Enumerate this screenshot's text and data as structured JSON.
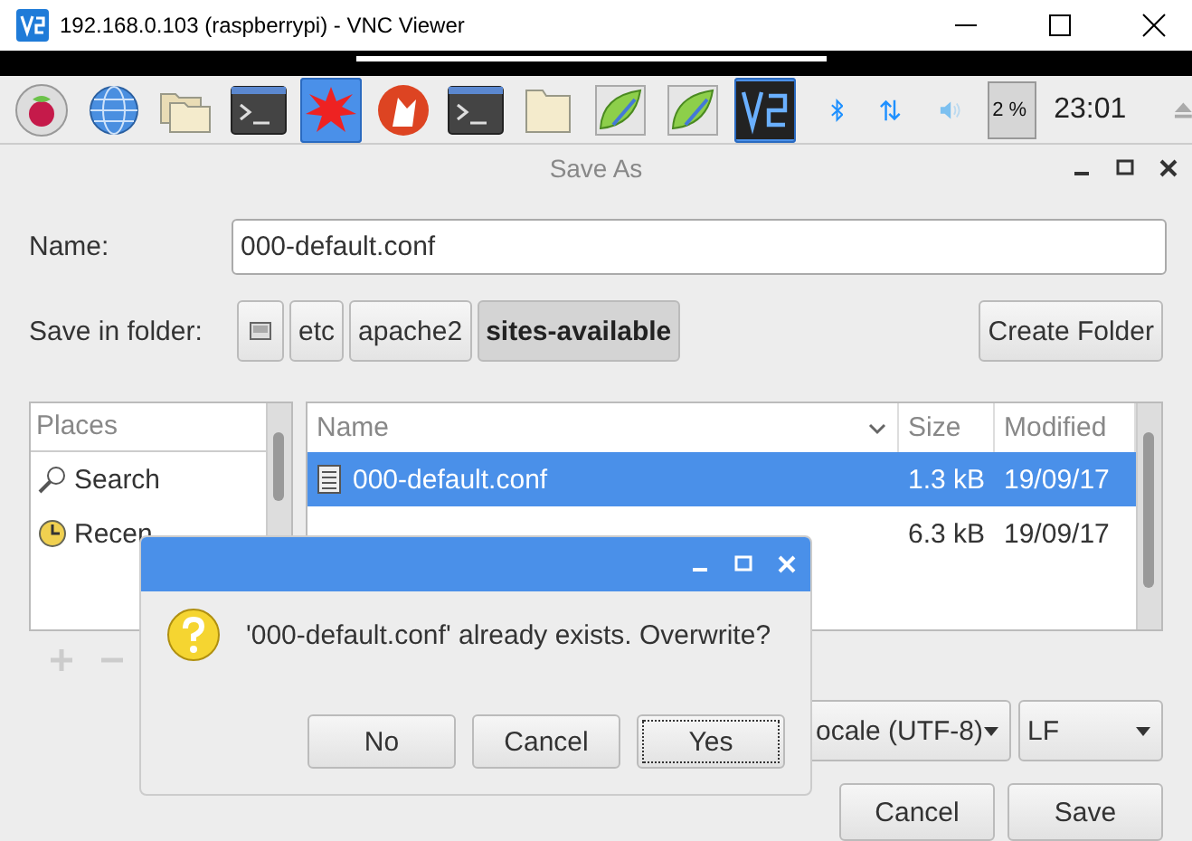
{
  "window": {
    "title": "192.168.0.103 (raspberrypi) - VNC Viewer"
  },
  "taskbar": {
    "launchers": [
      {
        "kind": "raspberry",
        "active": false
      },
      {
        "kind": "globe",
        "active": false
      },
      {
        "kind": "folders",
        "active": false
      },
      {
        "kind": "terminal",
        "active": false
      },
      {
        "kind": "burst",
        "active": true
      },
      {
        "kind": "wolf",
        "active": false
      },
      {
        "kind": "terminal",
        "active": false
      },
      {
        "kind": "folder",
        "active": false
      },
      {
        "kind": "leaf",
        "active": false
      },
      {
        "kind": "leaf",
        "active": false
      },
      {
        "kind": "vnc",
        "active": true
      }
    ],
    "tray": [
      {
        "kind": "bluetooth"
      },
      {
        "kind": "network"
      },
      {
        "kind": "volume"
      }
    ],
    "cpu": "2 %",
    "clock": "23:01"
  },
  "save_dialog": {
    "title": "Save As",
    "name_label": "Name:",
    "name_value": "000-default.conf",
    "folder_label": "Save in folder:",
    "path": [
      {
        "kind": "drive",
        "selected": false
      },
      {
        "kind": "folder",
        "label": "etc",
        "selected": false
      },
      {
        "kind": "folder",
        "label": "apache2",
        "selected": false
      },
      {
        "kind": "folder",
        "label": "sites-available",
        "selected": true
      }
    ],
    "create_folder": "Create Folder",
    "places": {
      "header": "Places",
      "items": [
        {
          "kind": "search",
          "label": "Search"
        },
        {
          "kind": "recent",
          "label": "Recen"
        }
      ]
    },
    "files": {
      "columns": [
        "Name",
        "Size",
        "Modified"
      ],
      "rows": [
        {
          "name": "000-default.conf",
          "size": "1.3 kB",
          "modified": "19/09/17",
          "selected": true
        },
        {
          "size": "6.3 kB",
          "modified": "19/09/17",
          "selected": false
        }
      ]
    },
    "encoding": "ocale (UTF-8)",
    "line_ending": "LF",
    "buttons": [
      "Cancel",
      "Save"
    ]
  },
  "confirm_dialog": {
    "message": "'000-default.conf' already exists. Overwrite?",
    "buttons": [
      {
        "label": "No",
        "focused": false
      },
      {
        "label": "Cancel",
        "focused": false
      },
      {
        "label": "Yes",
        "focused": true
      }
    ]
  }
}
